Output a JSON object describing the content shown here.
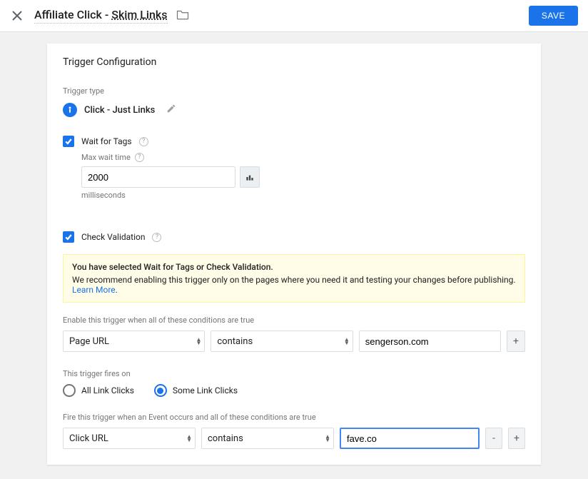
{
  "header": {
    "title_prefix": "Affiliate Click - ",
    "title_linked": "Skim Links",
    "save_label": "SAVE"
  },
  "card": {
    "heading": "Trigger Configuration",
    "trigger_type_label": "Trigger type",
    "trigger_type_name": "Click - Just Links",
    "wait_for_tags": {
      "label": "Wait for Tags",
      "max_wait_label": "Max wait time",
      "value": "2000",
      "units": "milliseconds"
    },
    "check_validation_label": "Check Validation",
    "info": {
      "bold": "You have selected Wait for Tags or Check Validation.",
      "text": "We recommend enabling this trigger only on the pages where you need it and testing your changes before publishing. ",
      "link": "Learn More"
    },
    "enable_label": "Enable this trigger when all of these conditions are true",
    "enable_row": {
      "variable": "Page URL",
      "operator": "contains",
      "value": "sengerson.com"
    },
    "fires_label": "This trigger fires on",
    "fires_options": {
      "all": "All Link Clicks",
      "some": "Some Link Clicks"
    },
    "fire_when_label": "Fire this trigger when an Event occurs and all of these conditions are true",
    "fire_row": {
      "variable": "Click URL",
      "operator": "contains",
      "value": "fave.co"
    }
  }
}
